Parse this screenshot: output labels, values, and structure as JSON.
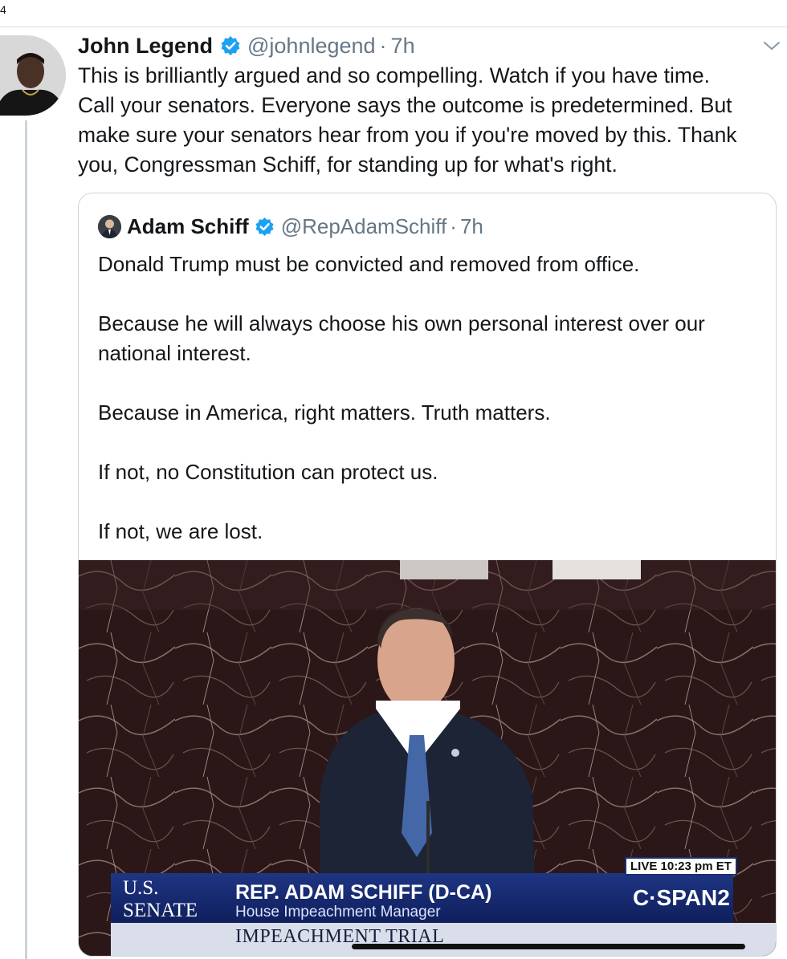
{
  "top_fragment": "4",
  "tweet": {
    "author_name": "John Legend",
    "handle": "@johnlegend",
    "separator": "·",
    "time": "7h",
    "text_lines": [
      "This is brilliantly argued and so compelling. Watch if you have time.",
      "Call your senators.  Everyone says the outcome is predetermined.  But",
      "make sure your senators hear from you if you're moved by this.  Thank",
      "you, Congressman Schiff, for standing up for what's right."
    ],
    "icons": {
      "avatar": "avatar-photo",
      "verified": "verified-badge-icon",
      "menu": "chevron-down-icon"
    }
  },
  "quoted": {
    "author_name": "Adam Schiff",
    "handle": "@RepAdamSchiff",
    "separator": "·",
    "time": "7h",
    "paragraphs": [
      "Donald Trump must be convicted and removed from office.",
      "Because he will always choose his own personal interest over our\nnational interest.",
      "Because in America, right matters. Truth matters.",
      "If not, no Constitution can protect us.",
      "If not, we are lost."
    ],
    "video": {
      "live_badge": "LIVE 10:23 pm ET",
      "senate_line1": "U.S.",
      "senate_line2": "SENATE",
      "chyron_name": "REP. ADAM SCHIFF (D-CA)",
      "chyron_title": "House Impeachment Manager",
      "network": "C·SPAN2",
      "banner": "IMPEACHMENT TRIAL"
    }
  },
  "colors": {
    "text": "#14171a",
    "secondary": "#657786",
    "verified": "#1da1f2",
    "border": "#ccd6dd",
    "chyron_blue": "#1f3584"
  }
}
